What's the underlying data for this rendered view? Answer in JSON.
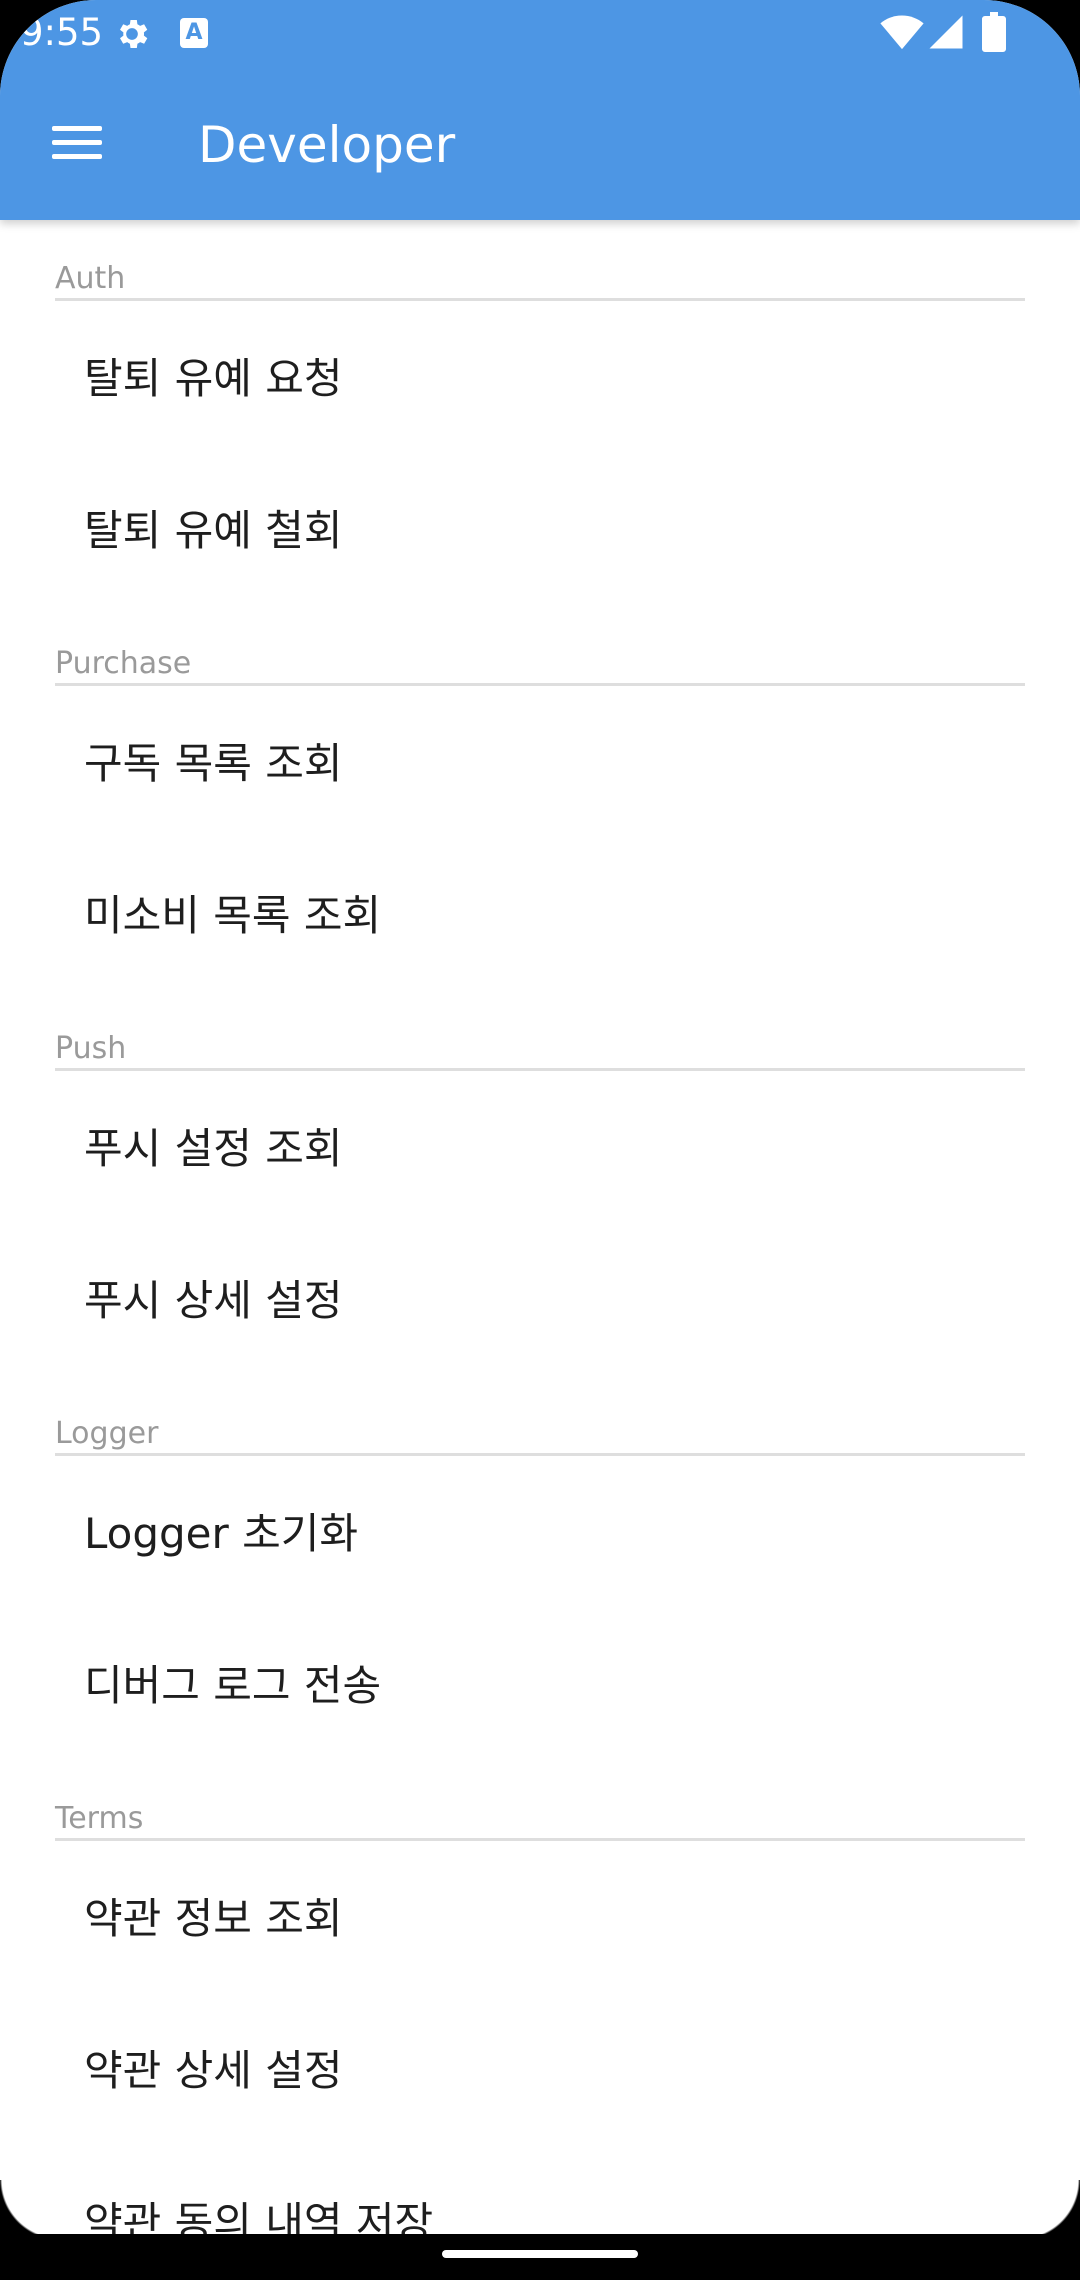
{
  "status_bar": {
    "time": "9:55",
    "icons": [
      "gear-icon",
      "a-icon",
      "wifi-icon",
      "signal-icon",
      "battery-icon"
    ],
    "a_glyph": "A"
  },
  "app_bar": {
    "title": "Developer",
    "background": "#4d96e4",
    "menu_icon": "hamburger-menu-icon"
  },
  "sections": [
    {
      "header": "Auth",
      "items": [
        "탈퇴 유예 요청",
        "탈퇴 유예 철회"
      ]
    },
    {
      "header": "Purchase",
      "items": [
        "구독 목록 조회",
        "미소비 목록 조회"
      ]
    },
    {
      "header": "Push",
      "items": [
        "푸시 설정 조회",
        "푸시 상세 설정"
      ]
    },
    {
      "header": "Logger",
      "items": [
        "Logger 초기화",
        "디버그 로그 전송"
      ]
    },
    {
      "header": "Terms",
      "items": [
        "약관 정보 조회",
        "약관 상세 설정",
        "약관 동의 내역 저장"
      ]
    }
  ]
}
